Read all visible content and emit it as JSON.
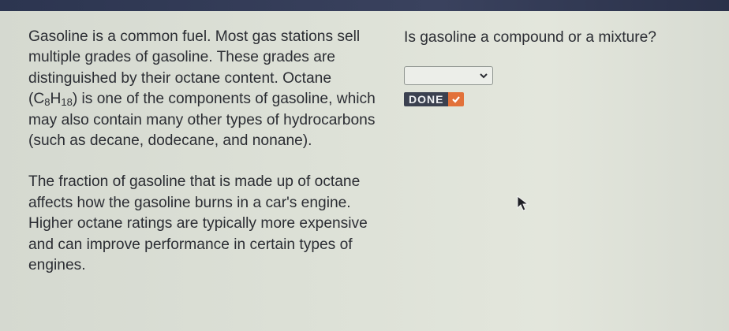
{
  "passage": {
    "p1_a": "Gasoline is a common fuel. Most gas stations sell multiple grades of gasoline. These grades are distinguished by their octane content. Octane (C",
    "p1_sub1": "8",
    "p1_mid": "H",
    "p1_sub2": "18",
    "p1_b": ") is one of the components of gasoline, which may also contain many other types of hydrocarbons (such as decane, dodecane, and nonane).",
    "p2": "The fraction of gasoline that is made up of octane affects how the gasoline burns in a car's engine. Higher octane ratings are typically more expensive and can improve performance in certain types of engines."
  },
  "question": {
    "text": "Is gasoline a compound or a mixture?",
    "dropdown_value": "",
    "done_label": "DONE"
  },
  "icons": {
    "dropdown": "chevron-down-icon",
    "done": "checkmark-icon",
    "cursor": "mouse-pointer-icon"
  },
  "colors": {
    "done_bg": "#3b4150",
    "check_bg": "#e2713a"
  }
}
